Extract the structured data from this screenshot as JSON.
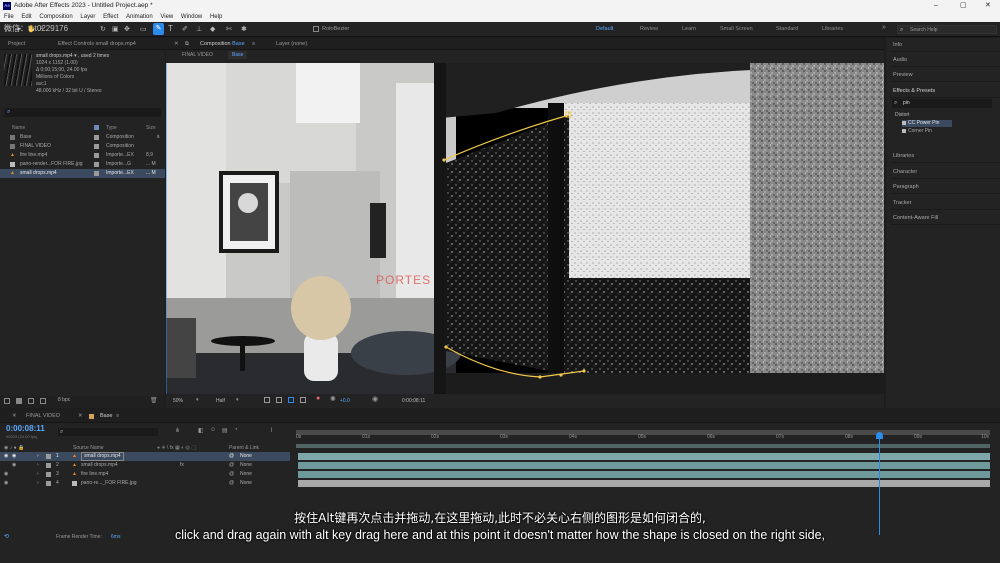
{
  "window": {
    "title": "Adobe After Effects 2023 - Untitled Project.aep *",
    "app_icon": "Ae"
  },
  "menu": [
    "File",
    "Edit",
    "Composition",
    "Layer",
    "Effect",
    "Animation",
    "View",
    "Window",
    "Help"
  ],
  "toolbar": {
    "rotobezier": "RotoBezier",
    "workspaces": [
      "Default",
      "Review",
      "Learn",
      "Small Screen",
      "Standard",
      "Libraries"
    ],
    "search_placeholder": "Search Help"
  },
  "project": {
    "tabs": {
      "project": "Project",
      "effect_controls": "Effect Controls small drops.mp4"
    },
    "watermark": "微信：tut0229176",
    "info_name": "small drops.mp4 ▾ , used 2 times",
    "info_lines": [
      "1024 x 1152 (1.00)",
      "Δ 0;00;15;00, 24.00 fps",
      "Millions of Colors",
      "avc1",
      "48.000 kHz / 32 bit U / Stereo"
    ],
    "columns": {
      "name": "Name",
      "type": "Type",
      "size": "Size"
    },
    "items": [
      {
        "name": "Base",
        "type": "Composition",
        "size": "",
        "color": "#9b9b9b"
      },
      {
        "name": "FINAL VIDEO",
        "type": "Composition",
        "size": "",
        "color": "#9b9b9b"
      },
      {
        "name": "fire line.mp4",
        "type": "Importe...EX",
        "size": "8,9",
        "color": "#9b9b9b"
      },
      {
        "name": "pano-render...FOR FIRE.jpg",
        "type": "Importe...G",
        "size": "... M",
        "color": "#9b9b9b"
      },
      {
        "name": "small drops.mp4",
        "type": "Importe...EX",
        "size": "... M",
        "color": "#9b9b9b"
      }
    ],
    "bpc": "8 bpc"
  },
  "comp": {
    "tab_label": "Composition",
    "tab_name": "Base",
    "layer_tab": "Layer (none)",
    "breadcrumbs": [
      "FINAL VIDEO",
      "Base"
    ],
    "watermark": "PORTES",
    "zoom": "50%",
    "resolution": "Half",
    "timecode": "0:00:08:11",
    "exposure": "+0.0"
  },
  "right_panels": [
    "Info",
    "Audio",
    "Preview",
    "Effects & Presets",
    "Libraries",
    "Character",
    "Paragraph",
    "Tracker",
    "Content-Aware Fill"
  ],
  "effects": {
    "search": "pin",
    "category": "Distort",
    "items": [
      "CC Power Pin",
      "Corner Pin"
    ]
  },
  "timeline": {
    "tabs": [
      "FINAL VIDEO",
      "Base"
    ],
    "current_time": "0:00:08:11",
    "fps_sub": "00203 (24.00 fps)",
    "col_source": "Source Name",
    "col_parent": "Parent & Link",
    "ruler": [
      "0s",
      "01s",
      "02s",
      "03s",
      "04s",
      "05s",
      "06s",
      "07s",
      "08s",
      "09s",
      "10s"
    ],
    "layers": [
      {
        "num": "1",
        "name": "small drops.mp4",
        "parent": "None"
      },
      {
        "num": "2",
        "name": "small drops.mp4",
        "parent": "None"
      },
      {
        "num": "3",
        "name": "fire line.mp4",
        "parent": "None"
      },
      {
        "num": "4",
        "name": "pano-re..._FOR FIRE.jpg",
        "parent": "None"
      }
    ],
    "render_label": "Frame Render Time:",
    "render_value": "6ms"
  },
  "subtitles": {
    "zh": "按住Alt键再次点击并拖动,在这里拖动,此时不必关心右侧的图形是如何闭合的,",
    "en": "click and drag again with alt key drag here and at this point it doesn't matter how the shape is closed on the right side,"
  },
  "colors": {
    "accent": "#2d8ceb",
    "layer_bar": "#7fa8aa",
    "selection": "#3c4a60"
  }
}
